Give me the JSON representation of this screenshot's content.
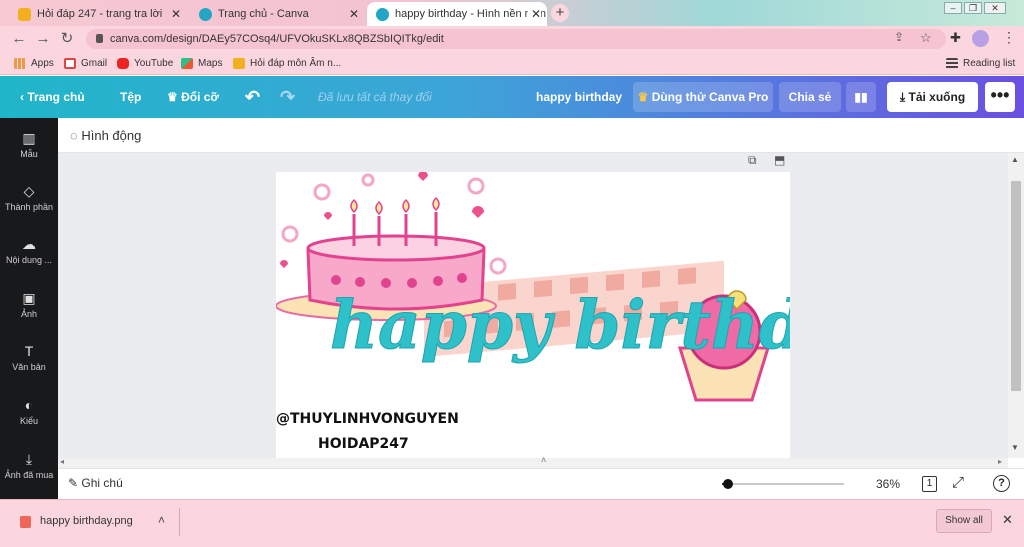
{
  "browser": {
    "tabs": [
      {
        "title": "Hỏi đáp 247 - trang tra lời",
        "active": false
      },
      {
        "title": "Trang chủ - Canva",
        "active": false
      },
      {
        "title": "happy birthday - Hình nền màn h",
        "active": true
      }
    ],
    "new_tab_symbol": "+",
    "url": "canva.com/design/DAEy57COsq4/UFVOkuSKLx8QBZSbIQITkg/edit",
    "bookmarks": [
      "Apps",
      "Gmail",
      "YouTube",
      "Maps",
      "Hỏi đáp môn Âm n..."
    ],
    "reading_list": "Reading list"
  },
  "canva": {
    "toolbar": {
      "home": "Trang chủ",
      "file": "Tệp",
      "resize": "Đổi cỡ",
      "saved_status": "Đã lưu tất cả thay đổi",
      "design_title": "happy birthday",
      "try_pro": "Dùng thử Canva Pro",
      "share": "Chia sẻ",
      "download": "Tải xuống"
    },
    "sidebar": [
      {
        "label": "Mẫu",
        "icon": "template-icon"
      },
      {
        "label": "Thành phần",
        "icon": "elements-icon"
      },
      {
        "label": "Nội dung ...",
        "icon": "upload-icon"
      },
      {
        "label": "Ảnh",
        "icon": "photo-icon"
      },
      {
        "label": "Văn bản",
        "icon": "text-icon"
      },
      {
        "label": "Kiểu",
        "icon": "palette-icon"
      },
      {
        "label": "Ảnh đã mua",
        "icon": "download-arrow-icon"
      }
    ],
    "animate_label": "Hình động",
    "canvas": {
      "headline": "happy birthday",
      "watermark_line1": "@THUYLINHVONGUYEN",
      "watermark_line2": "HOIDAP247"
    },
    "footer": {
      "notes": "Ghi chú",
      "zoom": "36%",
      "zoom_value": 0.36,
      "page_count": "1"
    }
  },
  "downloads": {
    "file_name": "happy birthday.png",
    "show_all": "Show all"
  },
  "colors": {
    "toolbar_start": "#20b6c9",
    "toolbar_end": "#6a4fe0",
    "cake_pink": "#f28ab8",
    "headline_teal": "#2fc1c9",
    "ribbon_coral": "#f29b8c"
  }
}
